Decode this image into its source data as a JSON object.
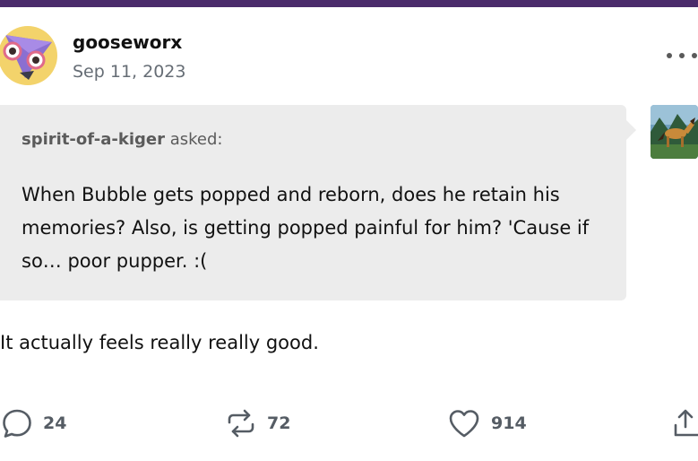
{
  "post": {
    "author": "gooseworx",
    "date": "Sep 11, 2023"
  },
  "ask": {
    "asker": "spirit-of-a-kiger",
    "asked_label": "asked:",
    "question": "When Bubble gets popped and reborn, does he retain his memories? Also, is getting popped painful for him? 'Cause if so… poor pupper. :("
  },
  "answer": "It actually feels really really good.",
  "actions": {
    "replies": "24",
    "reblogs": "72",
    "likes": "914"
  },
  "icons": {
    "more": "more-options-icon",
    "reply": "speech-bubble-icon",
    "reblog": "reblog-arrows-icon",
    "like": "heart-icon",
    "share": "share-icon"
  },
  "colors": {
    "top_bar": "#4b2b6b",
    "ask_background": "#ececec",
    "muted_text": "#666d75"
  }
}
